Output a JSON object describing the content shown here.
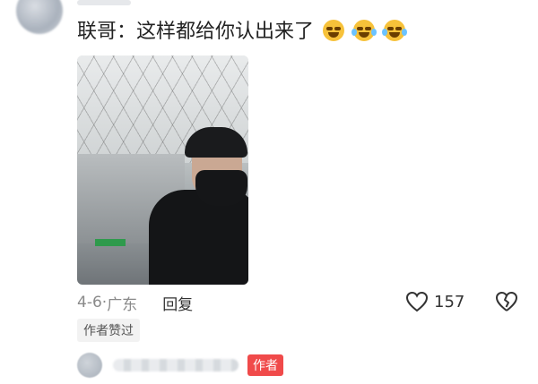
{
  "comment": {
    "author": "联哥",
    "separator": "：",
    "text": "这样都给你认出来了",
    "emojis": [
      "grin-sweat-emoji",
      "laugh-cry-emoji",
      "laugh-cry-emoji"
    ]
  },
  "meta": {
    "date": "4-6",
    "dot": "·",
    "location": "广东",
    "reply_label": "回复"
  },
  "likes": {
    "count": "157"
  },
  "liked_by_author_label": "作者赞过",
  "reply_preview": {
    "author_badge": "作者"
  },
  "colors": {
    "badge_red": "#f04a4a",
    "meta_gray": "#8a8a8a",
    "emoji_yellow": "#f7c23a"
  }
}
